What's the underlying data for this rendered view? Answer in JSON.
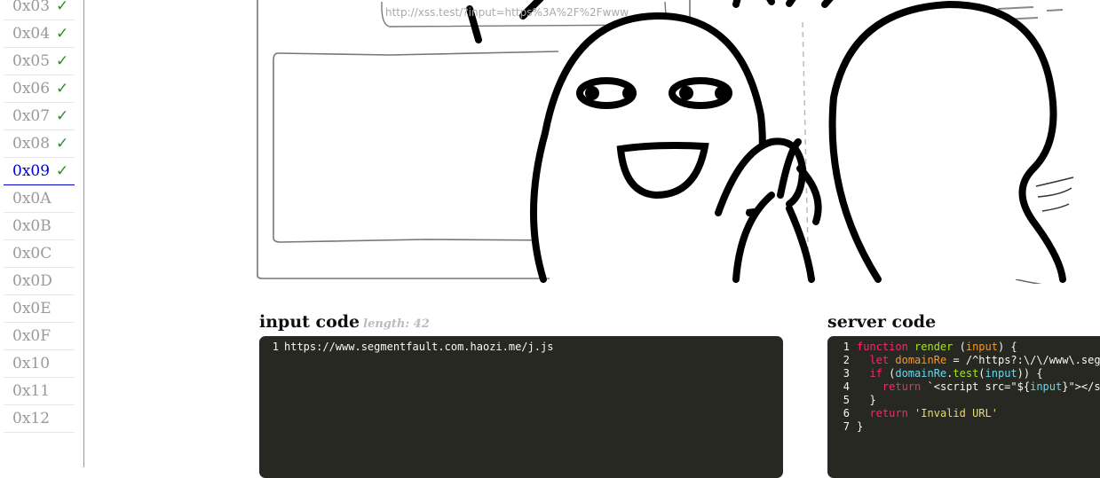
{
  "sidebar": {
    "levels": [
      {
        "label": "0x03",
        "done": true,
        "check": "✓"
      },
      {
        "label": "0x04",
        "done": true,
        "check": "✓"
      },
      {
        "label": "0x05",
        "done": true,
        "check": "✓"
      },
      {
        "label": "0x06",
        "done": true,
        "check": "✓"
      },
      {
        "label": "0x07",
        "done": true,
        "check": "✓"
      },
      {
        "label": "0x08",
        "done": true,
        "check": "✓"
      },
      {
        "label": "0x09",
        "done": true,
        "check": "✓",
        "active": true
      },
      {
        "label": "0x0A",
        "done": false
      },
      {
        "label": "0x0B",
        "done": false
      },
      {
        "label": "0x0C",
        "done": false
      },
      {
        "label": "0x0D",
        "done": false
      },
      {
        "label": "0x0E",
        "done": false
      },
      {
        "label": "0x0F",
        "done": false
      },
      {
        "label": "0x10",
        "done": false
      },
      {
        "label": "0x11",
        "done": false
      },
      {
        "label": "0x12",
        "done": false
      }
    ],
    "active_color": "#0000cc",
    "check_color": "#2e8b2e"
  },
  "preview": {
    "nav_glyphs": {
      "back": "←",
      "forward": "→",
      "reload": "↻"
    },
    "address": "http://xss.test/?input=https%3A%2F%2Fwww"
  },
  "input_panel": {
    "title": "input code",
    "length_hint": "length: 42",
    "lines": [
      "https://www.segmentfault.com.haozi.me/j.js"
    ]
  },
  "server_panel": {
    "title": "server code",
    "line_numbers": [
      "1",
      "2",
      "3",
      "4",
      "5",
      "6",
      "7"
    ],
    "tokens": {
      "l1": [
        "function",
        " ",
        "render",
        " (",
        "input",
        ") {"
      ],
      "l2": [
        "  ",
        "let",
        " ",
        "domainRe",
        " = /^https?:\\/\\/www\\.seg"
      ],
      "l3": [
        "  ",
        "if",
        " (",
        "domainRe",
        ".",
        "test",
        "(",
        "input",
        ")) {"
      ],
      "l4": [
        "    ",
        "return",
        " `<script src=\"${",
        "input",
        "}\"></s"
      ],
      "l5": [
        "  }"
      ],
      "l6": [
        "  ",
        "return",
        " ",
        "'Invalid URL'"
      ],
      "l7": [
        "}"
      ]
    }
  },
  "colors": {
    "editor_bg": "#272822",
    "keyword": "#f92672",
    "function": "#a6e22e",
    "param": "#fd971f",
    "string": "#e6db74",
    "identifier": "#66d9ef"
  }
}
